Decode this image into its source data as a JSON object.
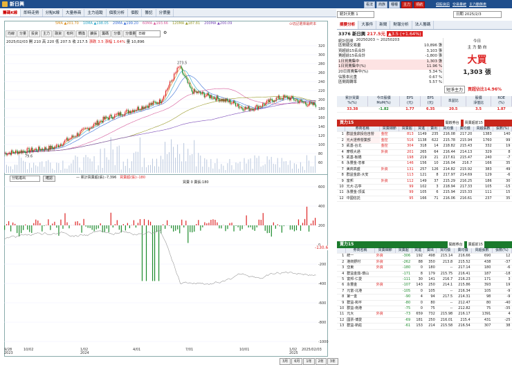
{
  "window": {
    "title": "新日興"
  },
  "top_tabs": [
    "籌碼K線",
    "即時走勢",
    "分點K線",
    "大量券商",
    "主力追蹤",
    "個股分析",
    "個股",
    "籌記",
    "分價量"
  ],
  "right_top_buttons": [
    "看法",
    "商族",
    "種種",
    "主力",
    "領航"
  ],
  "right_top_links": [
    "個股資訊",
    "交易量統",
    "主力動態表"
  ],
  "chart_toolbar": [
    "均線",
    "分量",
    "投資",
    "主力",
    "融資",
    "有利",
    "轉換",
    "擴張",
    "籌碼",
    "分價",
    "分價量"
  ],
  "chart_toolbar_select": "日線",
  "ma_legend": [
    {
      "label": "5MA ▲201.70",
      "color": "#d98b1a"
    },
    {
      "label": "10MA ▲198.05",
      "color": "#2aa6c9"
    },
    {
      "label": "20MA ▲199.20",
      "color": "#3a6fd8"
    },
    {
      "label": "60MA ▲193.66",
      "color": "#d65a9a"
    },
    {
      "label": "120MA ▲187.81",
      "color": "#9a9a2a"
    },
    {
      "label": "200MA ▲200.09",
      "color": "#7a4ab8"
    }
  ],
  "chart_notice": "⊙切記選擇最終本",
  "ohlc": {
    "date": "2025/02/03",
    "open": "開 210",
    "high": "高 220",
    "low": "低 207.5",
    "close": "收 217.5",
    "change": "漲跌 3.5",
    "pct": "漲幅 1.64%",
    "vol": "量 10,896"
  },
  "price_axis": [
    "320",
    "300",
    "280",
    "260",
    "240",
    "220",
    "200",
    "180",
    "160",
    "140",
    "120",
    "100",
    "80",
    "60"
  ],
  "peak_label": "273.5",
  "low_label": "79.6",
  "sub_panel": {
    "select": "分點進出",
    "button": "確認",
    "legend_a": "— 累計買賣超(張):-7,396",
    "legend_b": "買賣超(張):-180",
    "legend_c": "買賣 0 賣張:180",
    "last_value": "-130.6"
  },
  "sub_axis": [
    "600",
    "400",
    "200",
    "0",
    "-200",
    "-400",
    "-600",
    "-800",
    "-1000"
  ],
  "x_axis": [
    "9/28\n2023",
    "10/02",
    "1/02\n2024",
    "4/01",
    "7/01",
    "10/01",
    "1/02\n2025",
    "2025/02/03"
  ],
  "range_buttons": [
    "3月",
    "6月",
    "1年",
    "2年",
    "3年"
  ],
  "stat_select": "統計天數 1",
  "date_field": "日期 2025/2/3",
  "right_tabs": [
    "摘要分析",
    "大事件",
    "新聞",
    "財報分析",
    "法人籌碼"
  ],
  "stock": {
    "name": "3376 新日興",
    "price": "217.5元",
    "change": "▲3.5 (+1.64%)"
  },
  "summary": {
    "period_label": "統計區間",
    "period": "20250203 ~ 20250203",
    "rows": [
      {
        "k": "區間總交易量",
        "v": "10,896 張"
      },
      {
        "k": "買超前15名合計",
        "v": "3,103 張"
      },
      {
        "k": "賣超前15名合計",
        "v": "-1,800 張"
      },
      {
        "k": "1日買賣集中",
        "v": "1,303 張"
      },
      {
        "k": "1日買賣集中(%)",
        "v": "11.96 %"
      },
      {
        "k": "20日買賣集中(%)",
        "v": "5.34 %"
      },
      {
        "k": "佔股本比重",
        "v": "0.67 %"
      },
      {
        "k": "區間周轉率",
        "v": "5.57 %"
      }
    ]
  },
  "today": {
    "label": "今日",
    "sub": "主 力 動 向",
    "verdict": "大買",
    "amount": "1,303 張"
  },
  "net_label": "短淨主力",
  "net_value": "買超佔比14.96%",
  "metrics": {
    "heads": [
      "累計買賣\n%(%)",
      "今日股價\nMoM(%)",
      "EPS\n(元)",
      "EPS\n(元)",
      "本益比",
      "股價\n淨值比",
      "ROE\n(%)"
    ],
    "vals": [
      "33.38",
      "-1.82",
      "1.77",
      "6.35",
      "20.5",
      "3.5",
      "1.87"
    ]
  },
  "buy_panel": {
    "title": "買力15",
    "mode": "開啟券台",
    "sort": "買賣超前15",
    "heads": [
      "",
      "券商名稱",
      "買賣細節",
      "買賣超",
      "買進",
      "賣出",
      "買均價",
      "賣均價",
      "買超張數",
      "張數(%)"
    ],
    "rows": [
      [
        "1",
        "群益金鼎投信自營",
        "金控",
        "813",
        "1149",
        "235",
        "216.08",
        "217.20",
        "1383",
        "140"
      ],
      [
        "2",
        "元大證券營業部",
        "金控",
        "516",
        "1138",
        "622",
        "215.78",
        "215.94",
        "1760",
        "99"
      ],
      [
        "3",
        "凱基-台北",
        "金控",
        "304",
        "318",
        "14",
        "218.82",
        "215.43",
        "332",
        "19"
      ],
      [
        "4",
        "摩根大通",
        "外資",
        "201",
        "265",
        "64",
        "216.44",
        "214.13",
        "329",
        "8"
      ],
      [
        "5",
        "凱基-板橋",
        "",
        "198",
        "219",
        "21",
        "217.61",
        "215.47",
        "240",
        "-7"
      ],
      [
        "6",
        "永豐金-忠孝",
        "",
        "146",
        "156",
        "10",
        "216.04",
        "216.7",
        "166",
        "35"
      ],
      [
        "7",
        "美商高盛",
        "外資",
        "131",
        "257",
        "126",
        "214.82",
        "215.92",
        "383",
        "49"
      ],
      [
        "8",
        "群益金鼎-大安",
        "",
        "113",
        "121",
        "8",
        "217.97",
        "214.69",
        "129",
        "-6"
      ],
      [
        "9",
        "富邦",
        "外資",
        "112",
        "149",
        "37",
        "215.29",
        "216.25",
        "186",
        "30"
      ],
      [
        "10",
        "元大-古亭",
        "",
        "99",
        "102",
        "3",
        "218.94",
        "217.33",
        "105",
        "-15"
      ],
      [
        "11",
        "永豐金-頂溪",
        "",
        "99",
        "105",
        "6",
        "215.94",
        "215.33",
        "111",
        "15"
      ],
      [
        "12",
        "中國信託",
        "",
        "95",
        "166",
        "71",
        "216.06",
        "216.61",
        "237",
        "35"
      ]
    ]
  },
  "sell_panel": {
    "title": "賣力15",
    "mode": "開啟券台",
    "sort": "賣超前15",
    "heads": [
      "",
      "券商名稱",
      "買賣細節",
      "買賣超",
      "買進",
      "賣出",
      "買均價",
      "賣均價",
      "買超張數",
      "張數(%)"
    ],
    "rows": [
      [
        "1",
        "統一",
        "外資",
        "-306",
        "192",
        "498",
        "215.14",
        "216.66",
        "690",
        "12"
      ],
      [
        "2",
        "港商野村",
        "外資",
        "-262",
        "88",
        "350",
        "213.8",
        "215.52",
        "438",
        "-37"
      ],
      [
        "3",
        "亞東",
        "外資",
        "-180",
        "0",
        "180",
        "--",
        "217.14",
        "180",
        "-6"
      ],
      [
        "4",
        "群益金鼎-環山",
        "",
        "-171",
        "8",
        "179",
        "215.75",
        "216.41",
        "187",
        "-18"
      ],
      [
        "5",
        "富邦-仁愛",
        "",
        "-111",
        "30",
        "141",
        "216.7",
        "216.23",
        "171",
        "3"
      ],
      [
        "6",
        "永豐金",
        "外資",
        "-107",
        "143",
        "250",
        "214.1",
        "215.86",
        "393",
        "19"
      ],
      [
        "7",
        "元富-北港",
        "",
        "-105",
        "0",
        "105",
        "--",
        "216.34",
        "105",
        "-9"
      ],
      [
        "8",
        "第一金",
        "",
        "-90",
        "4",
        "94",
        "217.5",
        "214.31",
        "98",
        "-9"
      ],
      [
        "9",
        "群益-和平",
        "",
        "-80",
        "0",
        "80",
        "--",
        "212.47",
        "80",
        "-40"
      ],
      [
        "10",
        "群益-南港",
        "",
        "-75",
        "0",
        "75",
        "--",
        "212.82",
        "75",
        "-35"
      ],
      [
        "11",
        "元大",
        "外資",
        "-73",
        "659",
        "732",
        "215.98",
        "216.17",
        "1391",
        "4"
      ],
      [
        "12",
        "國票-博愛",
        "",
        "-69",
        "181",
        "250",
        "216.01",
        "215.4",
        "431",
        "-25"
      ],
      [
        "13",
        "群益-新莊",
        "",
        "-61",
        "153",
        "214",
        "215.58",
        "216.54",
        "307",
        "38"
      ]
    ]
  }
}
